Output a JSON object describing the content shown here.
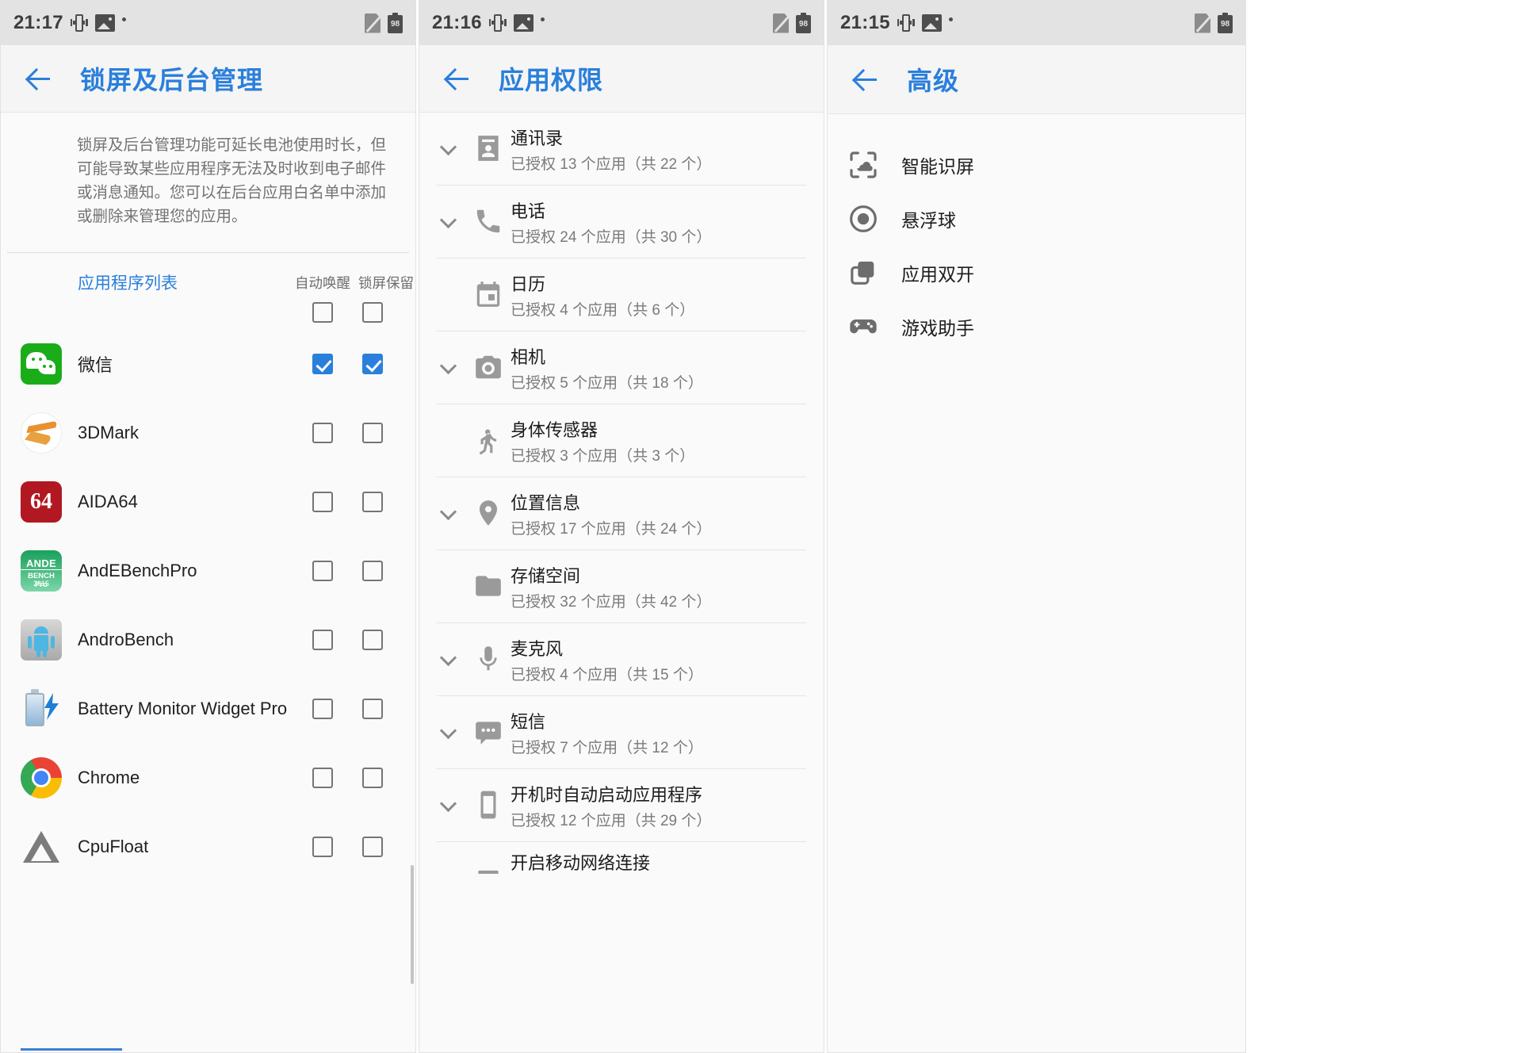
{
  "panels": [
    {
      "id": "lock-screen-background-management",
      "statusbar": {
        "time": "21:17",
        "battery": "98",
        "icons": [
          "vibrate-icon",
          "image-icon",
          "dot-icon",
          "no-sim-icon",
          "battery-icon"
        ]
      },
      "appbar": {
        "title": "锁屏及后台管理",
        "back": "back-arrow"
      },
      "description": "锁屏及后台管理功能可延长电池使用时长，但可能导致某些应用程序无法及时收到电子邮件或消息通知。您可以在后台应用白名单中添加或删除来管理您的应用。",
      "list_label": "应用程序列表",
      "col_headers": [
        "自动唤醒",
        "锁屏保留"
      ],
      "header_checks": [
        false,
        false
      ],
      "apps": [
        {
          "name": "微信",
          "icon": "wechat-icon",
          "auto_wake": true,
          "keep_on_lock": true
        },
        {
          "name": "3DMark",
          "icon": "3dmark-icon",
          "auto_wake": false,
          "keep_on_lock": false
        },
        {
          "name": "AIDA64",
          "icon": "aida64-icon",
          "auto_wake": false,
          "keep_on_lock": false
        },
        {
          "name": "AndEBenchPro",
          "icon": "andebenchpro-icon",
          "auto_wake": false,
          "keep_on_lock": false
        },
        {
          "name": "AndroBench",
          "icon": "androbench-icon",
          "auto_wake": false,
          "keep_on_lock": false
        },
        {
          "name": "Battery Monitor Widget Pro",
          "icon": "battery-monitor-icon",
          "auto_wake": false,
          "keep_on_lock": false
        },
        {
          "name": "Chrome",
          "icon": "chrome-icon",
          "auto_wake": false,
          "keep_on_lock": false
        },
        {
          "name": "CpuFloat",
          "icon": "cpufloat-icon",
          "auto_wake": false,
          "keep_on_lock": false
        }
      ]
    },
    {
      "id": "app-permissions",
      "statusbar": {
        "time": "21:16",
        "battery": "98"
      },
      "appbar": {
        "title": "应用权限",
        "back": "back-arrow"
      },
      "permissions": [
        {
          "title": "通讯录",
          "subtitle": "已授权 13 个应用（共 22 个）",
          "icon": "contacts-icon",
          "expandable": true
        },
        {
          "title": "电话",
          "subtitle": "已授权 24 个应用（共 30 个）",
          "icon": "phone-icon",
          "expandable": true
        },
        {
          "title": "日历",
          "subtitle": "已授权 4 个应用（共 6 个）",
          "icon": "calendar-icon",
          "expandable": false
        },
        {
          "title": "相机",
          "subtitle": "已授权 5 个应用（共 18 个）",
          "icon": "camera-icon",
          "expandable": true
        },
        {
          "title": "身体传感器",
          "subtitle": "已授权 3 个应用（共 3 个）",
          "icon": "body-sensor-icon",
          "expandable": false
        },
        {
          "title": "位置信息",
          "subtitle": "已授权 17 个应用（共 24 个）",
          "icon": "location-icon",
          "expandable": true
        },
        {
          "title": "存储空间",
          "subtitle": "已授权 32 个应用（共 42 个）",
          "icon": "folder-icon",
          "expandable": false
        },
        {
          "title": "麦克风",
          "subtitle": "已授权 4 个应用（共 15 个）",
          "icon": "microphone-icon",
          "expandable": true
        },
        {
          "title": "短信",
          "subtitle": "已授权 7 个应用（共 12 个）",
          "icon": "sms-icon",
          "expandable": true
        },
        {
          "title": "开机时自动启动应用程序",
          "subtitle": "已授权 12 个应用（共 29 个）",
          "icon": "phone-device-icon",
          "expandable": true
        },
        {
          "title": "开启移动网络连接",
          "subtitle": "",
          "icon": "mobile-network-icon",
          "expandable": false
        }
      ]
    },
    {
      "id": "advanced",
      "statusbar": {
        "time": "21:15",
        "battery": "98"
      },
      "appbar": {
        "title": "高级",
        "back": "back-arrow"
      },
      "items": [
        {
          "label": "智能识屏",
          "icon": "smart-screen-recognition-icon"
        },
        {
          "label": "悬浮球",
          "icon": "floating-ball-icon"
        },
        {
          "label": "应用双开",
          "icon": "app-clone-icon"
        },
        {
          "label": "游戏助手",
          "icon": "game-assistant-icon"
        }
      ]
    }
  ],
  "colors": {
    "accent": "#2a7fdb",
    "checkbox_on": "#2a7fdb",
    "statusbar_bg": "#e3e3e3",
    "panel_bg": "#fafafa"
  }
}
